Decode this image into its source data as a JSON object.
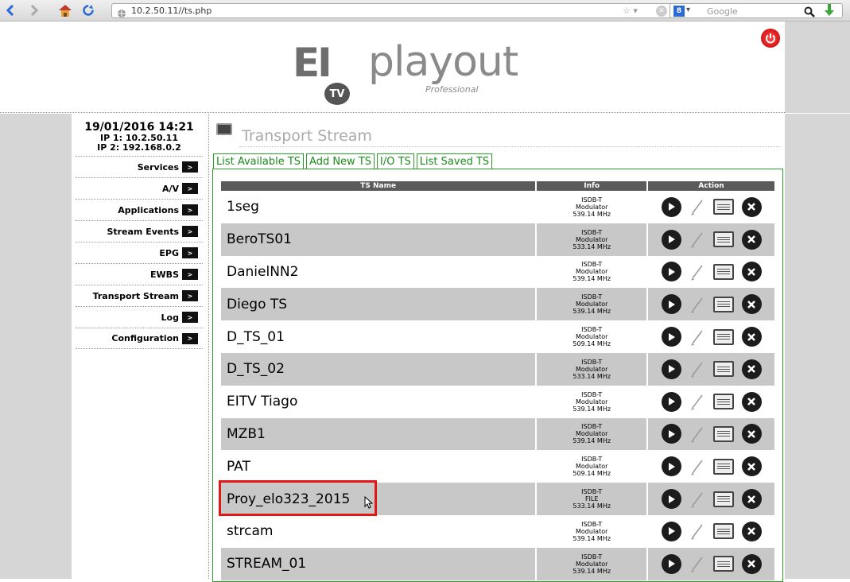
{
  "browser": {
    "url": "10.2.50.11//ts.php",
    "search_placeholder": "Google"
  },
  "header": {
    "logo_mark": "EI",
    "logo_tv": "TV",
    "logo_word": "playout",
    "logo_sub": "Professional"
  },
  "sidebar": {
    "datetime": "19/01/2016 14:21",
    "ip1": "IP 1: 10.2.50.11",
    "ip2": "IP 2: 192.168.0.2",
    "arrow": ">",
    "items": [
      {
        "label": "Services"
      },
      {
        "label": "A/V"
      },
      {
        "label": "Applications"
      },
      {
        "label": "Stream Events"
      },
      {
        "label": "EPG"
      },
      {
        "label": "EWBS"
      },
      {
        "label": "Transport Stream"
      },
      {
        "label": "Log"
      },
      {
        "label": "Configuration"
      }
    ]
  },
  "page": {
    "title": "Transport Stream",
    "tabs": [
      {
        "label": "List Available TS"
      },
      {
        "label": "Add New TS"
      },
      {
        "label": "I/O TS"
      },
      {
        "label": "List Saved TS"
      }
    ]
  },
  "table": {
    "headers": [
      "TS Name",
      "Info",
      "Action"
    ],
    "rows": [
      {
        "name": "1seg",
        "info1": "ISDB-T",
        "info2": "Modulator",
        "info3": "539.14 MHz"
      },
      {
        "name": "BeroTS01",
        "info1": "ISDB-T",
        "info2": "Modulator",
        "info3": "533.14 MHz"
      },
      {
        "name": "DanielNN2",
        "info1": "ISDB-T",
        "info2": "Modulator",
        "info3": "539.14 MHz"
      },
      {
        "name": "Diego TS",
        "info1": "ISDB-T",
        "info2": "Modulator",
        "info3": "539.14 MHz"
      },
      {
        "name": "D_TS_01",
        "info1": "ISDB-T",
        "info2": "Modulator",
        "info3": "509.14 MHz"
      },
      {
        "name": "D_TS_02",
        "info1": "ISDB-T",
        "info2": "Modulator",
        "info3": "533.14 MHz"
      },
      {
        "name": "EITV Tiago",
        "info1": "ISDB-T",
        "info2": "Modulator",
        "info3": "539.14 MHz"
      },
      {
        "name": "MZB1",
        "info1": "ISDB-T",
        "info2": "Modulator",
        "info3": "539.14 MHz"
      },
      {
        "name": "PAT",
        "info1": "ISDB-T",
        "info2": "Modulator",
        "info3": "509.14 MHz"
      },
      {
        "name": "Proy_elo323_2015",
        "info1": "ISDB-T",
        "info2": "FILE",
        "info3": "533.14 MHz"
      },
      {
        "name": "strcam",
        "info1": "ISDB-T",
        "info2": "Modulator",
        "info3": "539.14 MHz"
      },
      {
        "name": "STREAM_01",
        "info1": "ISDB-T",
        "info2": "Modulator",
        "info3": "539.14 MHz"
      }
    ]
  },
  "colors": {
    "tab_green": "#1a8c1a",
    "header_gray": "#5b5b5b",
    "row_alt": "#c8c8c8",
    "highlight_red": "#e01818"
  }
}
